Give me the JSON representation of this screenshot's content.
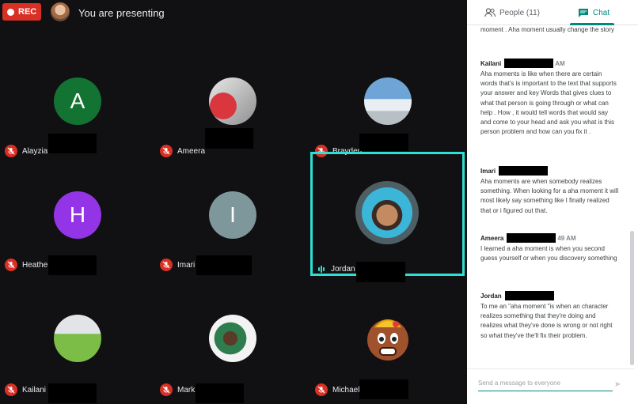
{
  "topbar": {
    "rec_label": "REC",
    "presenting_text": "You are presenting"
  },
  "participants": [
    {
      "name": "Alayzia",
      "initial": "A",
      "color": "#137333"
    },
    {
      "name": "Ameera"
    },
    {
      "name": "Brayden"
    },
    {
      "name": "Heather",
      "initial": "H",
      "color": "#9334e6"
    },
    {
      "name": "Imari",
      "initial": "I",
      "color": "#7d979b"
    },
    {
      "name": "Jordan"
    },
    {
      "name": "Kailani"
    },
    {
      "name": "Mark"
    },
    {
      "name": "Michael"
    }
  ],
  "panel": {
    "people_tab": "People (11)",
    "chat_tab": "Chat",
    "accent": "#00897b",
    "messages": [
      {
        "sender": "",
        "time": "",
        "text": "moment . Aha moment usually change the story"
      },
      {
        "sender": "Kailani",
        "time": "AM",
        "text": "Aha moments is like when there are certain words that's is important to the text that supports your answer and key Words that gives clues to what that person is going through or what can help . How , it would tell words that would say and come to your head and ask you what is this person problem and how can you fix it ."
      },
      {
        "sender": "Imari",
        "time": "",
        "text": "Aha moments are when somebody realizes something. When looking for a aha moment it will most likely say something like I finally realized that or i figured out that."
      },
      {
        "sender": "Ameera",
        "time": "49 AM",
        "text": "I learned a aha moment is when you second guess yourself or when you discovery something"
      },
      {
        "sender": "Jordan",
        "time": "",
        "text": "To me an \"aha moment \"is when an character realizes something that they're doing and realizes what they've done is wrong or not right so what they've the'll fix their problem."
      }
    ],
    "composer_placeholder": "Send a message to everyone"
  }
}
